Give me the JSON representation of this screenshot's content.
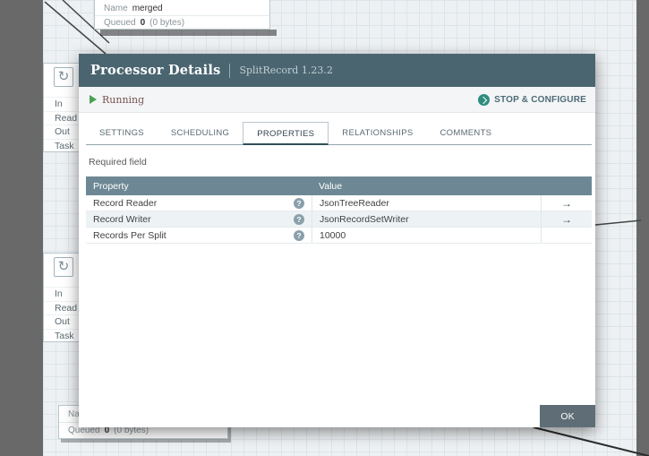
{
  "canvas": {
    "top_connection": {
      "name_label": "Name",
      "name_value": "merged",
      "queued_label": "Queued",
      "queued_count": "0",
      "queued_size": "(0 bytes)"
    },
    "processor_stats": [
      "In",
      "Read",
      "Out",
      "Task"
    ],
    "bottom_connection": {
      "name_label": "Name",
      "queued_label": "Queued",
      "queued_count": "0",
      "queued_size": "(0 bytes)"
    }
  },
  "dialog": {
    "title": "Processor Details",
    "subtitle": "SplitRecord 1.23.2",
    "status": {
      "label": "Running"
    },
    "actions": {
      "stop_configure": "STOP & CONFIGURE"
    },
    "tabs": [
      {
        "label": "SETTINGS"
      },
      {
        "label": "SCHEDULING"
      },
      {
        "label": "PROPERTIES"
      },
      {
        "label": "RELATIONSHIPS"
      },
      {
        "label": "COMMENTS"
      }
    ],
    "active_tab": "PROPERTIES",
    "required_field": "Required field",
    "table": {
      "headers": [
        "Property",
        "Value"
      ],
      "rows": [
        {
          "property": "Record Reader",
          "value": "JsonTreeReader",
          "has_link": true
        },
        {
          "property": "Record Writer",
          "value": "JsonRecordSetWriter",
          "has_link": true
        },
        {
          "property": "Records Per Split",
          "value": "10000",
          "has_link": false
        }
      ]
    },
    "ok_label": "OK"
  },
  "icons": {
    "help": "?",
    "goto": "→",
    "processor": "↻"
  },
  "colors": {
    "dialog_header": "#4a6570",
    "table_header": "#6d8894",
    "accent_teal": "#2f8d7e",
    "running_green": "#49a154",
    "running_text": "#7a5252",
    "ok_button": "#5f6e76"
  }
}
